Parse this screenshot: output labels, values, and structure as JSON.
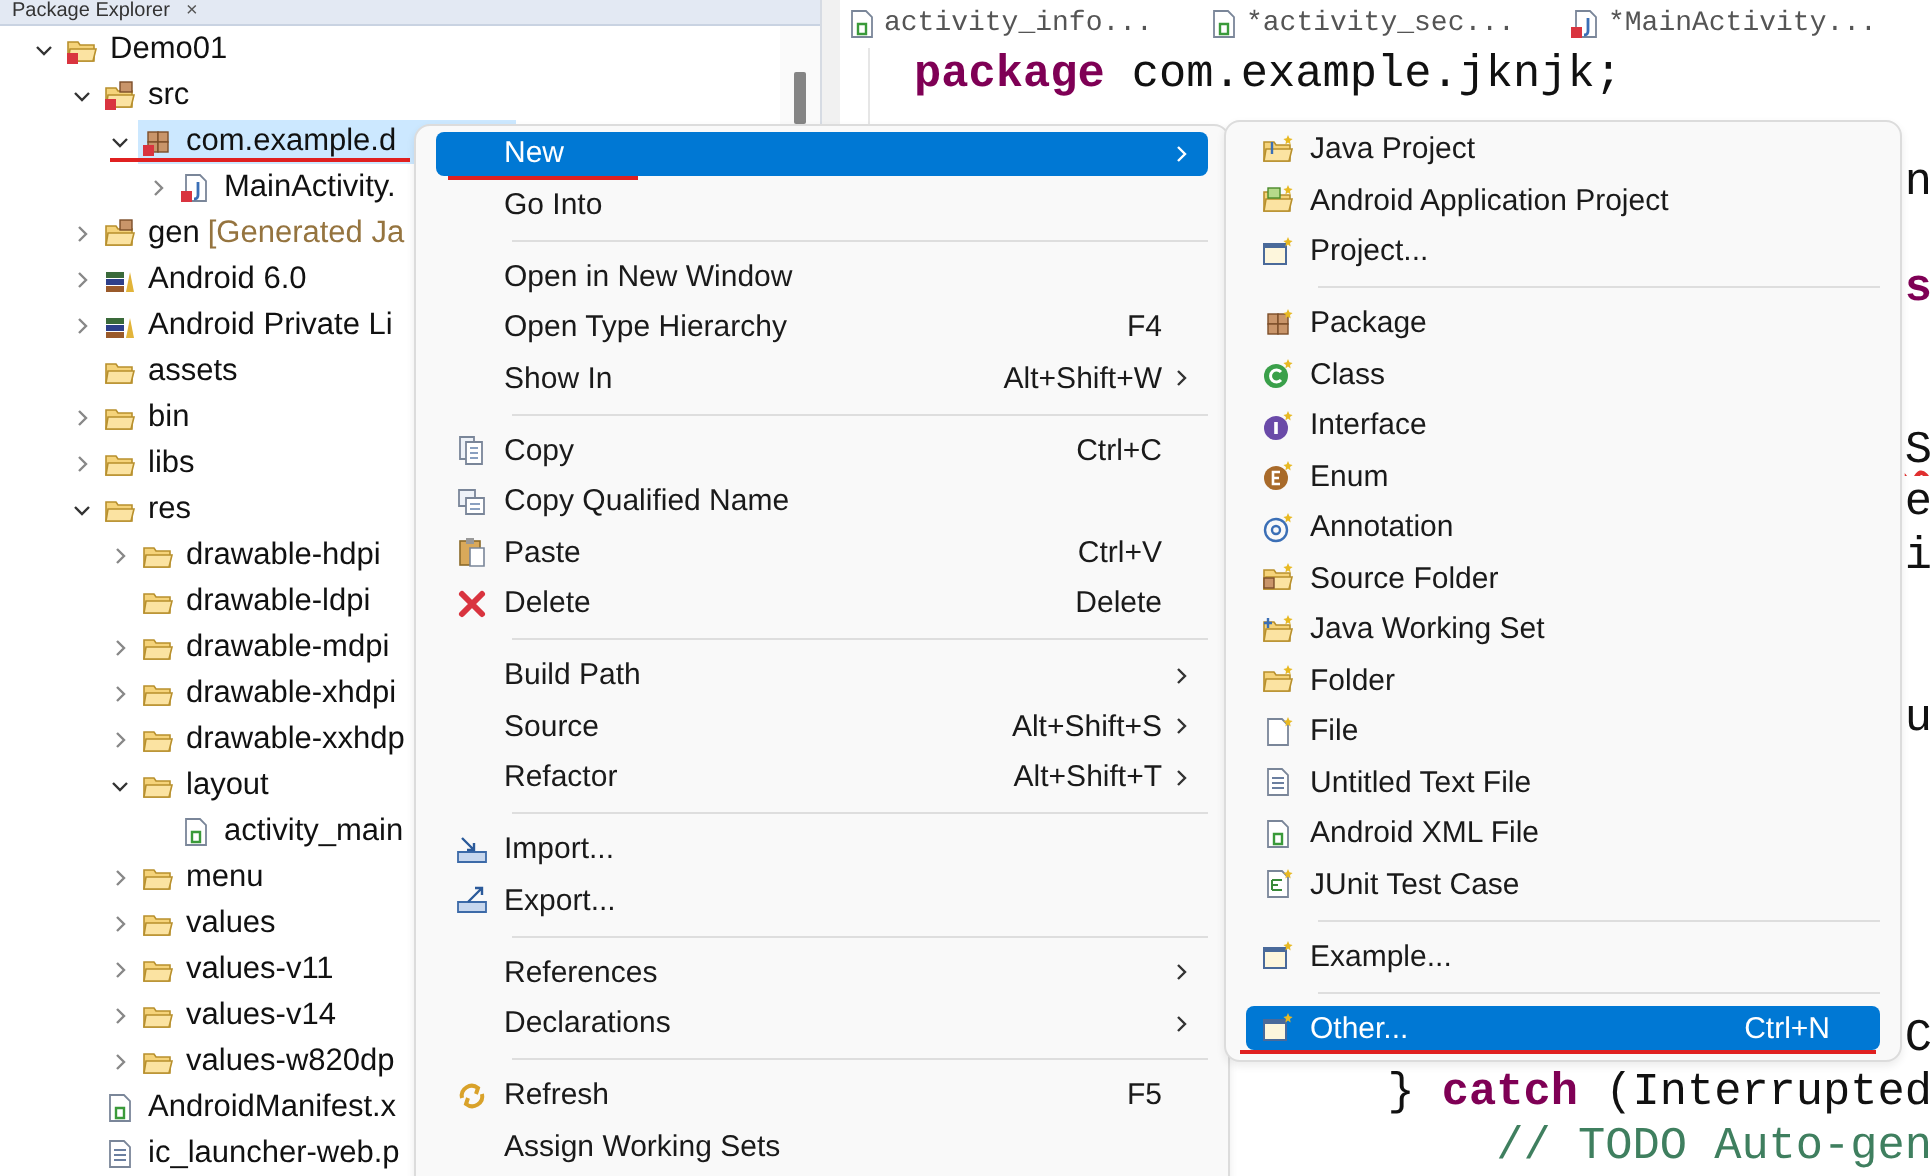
{
  "explorer": {
    "title": "Package Explorer",
    "close": "×",
    "tree": [
      {
        "label": "Demo01",
        "kind": "project",
        "expanded": true,
        "selected": false,
        "children": [
          {
            "label": "src",
            "kind": "source-folder",
            "expanded": true,
            "selected": false,
            "children": [
              {
                "label": "com.example.d",
                "kind": "package",
                "expanded": true,
                "selected": true,
                "children": [
                  {
                    "label": "MainActivity.",
                    "kind": "java-file",
                    "expanded": false,
                    "selected": false
                  }
                ]
              }
            ]
          },
          {
            "label": "gen",
            "decoration": "[Generated Ja",
            "kind": "gen-folder",
            "expanded": false,
            "selected": false
          },
          {
            "label": "Android 6.0",
            "kind": "library",
            "expanded": false,
            "selected": false
          },
          {
            "label": "Android Private Li",
            "kind": "library",
            "expanded": false,
            "selected": false
          },
          {
            "label": "assets",
            "kind": "folder",
            "selected": false
          },
          {
            "label": "bin",
            "kind": "folder",
            "expanded": false,
            "selected": false
          },
          {
            "label": "libs",
            "kind": "folder",
            "expanded": false,
            "selected": false
          },
          {
            "label": "res",
            "kind": "folder",
            "expanded": true,
            "selected": false,
            "children": [
              {
                "label": "drawable-hdpi",
                "kind": "folder",
                "expanded": false,
                "selected": false
              },
              {
                "label": "drawable-ldpi",
                "kind": "folder",
                "selected": false
              },
              {
                "label": "drawable-mdpi",
                "kind": "folder",
                "expanded": false,
                "selected": false
              },
              {
                "label": "drawable-xhdpi",
                "kind": "folder",
                "expanded": false,
                "selected": false
              },
              {
                "label": "drawable-xxhdp",
                "kind": "folder",
                "expanded": false,
                "selected": false
              },
              {
                "label": "layout",
                "kind": "folder",
                "expanded": true,
                "selected": false,
                "children": [
                  {
                    "label": "activity_main",
                    "kind": "xml-file",
                    "selected": false
                  }
                ]
              },
              {
                "label": "menu",
                "kind": "folder",
                "expanded": false,
                "selected": false
              },
              {
                "label": "values",
                "kind": "folder",
                "expanded": false,
                "selected": false
              },
              {
                "label": "values-v11",
                "kind": "folder",
                "expanded": false,
                "selected": false
              },
              {
                "label": "values-v14",
                "kind": "folder",
                "expanded": false,
                "selected": false
              },
              {
                "label": "values-w820dp",
                "kind": "folder",
                "expanded": false,
                "selected": false
              }
            ]
          },
          {
            "label": "AndroidManifest.x",
            "kind": "xml-file",
            "selected": false
          },
          {
            "label": "ic_launcher-web.p",
            "kind": "text-file",
            "selected": false
          }
        ]
      }
    ]
  },
  "editor": {
    "tabs": [
      {
        "label": "activity_info...",
        "kind": "xml-file"
      },
      {
        "label": "*activity_sec...",
        "kind": "xml-file"
      },
      {
        "label": "*MainActivity...",
        "kind": "java-file"
      }
    ],
    "code_lines": [
      {
        "kind": "head",
        "error": false,
        "segments": [
          {
            "text": "package",
            "kind": "keyword"
          },
          {
            "text": " com.example.jknjk;",
            "kind": "plain"
          }
        ]
      },
      {
        "kind": "tail",
        "error": false,
        "segments": [
          {
            "text": "n",
            "kind": "plain"
          }
        ]
      },
      {
        "kind": "tail",
        "error": false,
        "segments": [
          {
            "text": "s",
            "kind": "keyword"
          }
        ]
      },
      {
        "kind": "tail",
        "error": true,
        "segments": [
          {
            "text": "S",
            "kind": "plain"
          }
        ]
      },
      {
        "kind": "tail",
        "error": false,
        "segments": [
          {
            "text": "e",
            "kind": "plain"
          }
        ]
      },
      {
        "kind": "tail",
        "error": false,
        "segments": [
          {
            "text": "i",
            "kind": "plain"
          }
        ]
      },
      {
        "kind": "tail",
        "error": false,
        "segments": [
          {
            "text": "u",
            "kind": "plain"
          }
        ]
      },
      {
        "kind": "tail",
        "error": false,
        "segments": [
          {
            "text": "C",
            "kind": "plain"
          }
        ]
      },
      {
        "kind": "tail",
        "error": false,
        "segments": [
          {
            "text": "} ",
            "kind": "plain"
          },
          {
            "text": "catch",
            "kind": "keyword"
          },
          {
            "text": " (Interrupted",
            "kind": "plain"
          }
        ]
      },
      {
        "kind": "tail",
        "error": false,
        "segments": [
          {
            "text": "// TODO Auto-gen",
            "kind": "comment"
          }
        ]
      }
    ]
  },
  "context_menu": [
    {
      "kind": "plain",
      "label": "New",
      "submenu": true,
      "selected": true
    },
    {
      "kind": "plain",
      "label": "Go Into",
      "submenu": false,
      "selected": false
    },
    {
      "kind": "separator"
    },
    {
      "kind": "plain",
      "label": "Open in New Window",
      "submenu": false,
      "selected": false
    },
    {
      "kind": "plain",
      "label": "Open Type Hierarchy",
      "shortcut": "F4",
      "submenu": false,
      "selected": false
    },
    {
      "kind": "plain",
      "label": "Show In",
      "shortcut": "Alt+Shift+W",
      "submenu": true,
      "selected": false
    },
    {
      "kind": "separator"
    },
    {
      "kind": "copy",
      "label": "Copy",
      "shortcut": "Ctrl+C",
      "submenu": false,
      "selected": false
    },
    {
      "kind": "copy-name",
      "label": "Copy Qualified Name",
      "submenu": false,
      "selected": false
    },
    {
      "kind": "paste",
      "label": "Paste",
      "shortcut": "Ctrl+V",
      "submenu": false,
      "selected": false
    },
    {
      "kind": "delete",
      "label": "Delete",
      "shortcut": "Delete",
      "submenu": false,
      "selected": false
    },
    {
      "kind": "separator"
    },
    {
      "kind": "plain",
      "label": "Build Path",
      "submenu": true,
      "selected": false
    },
    {
      "kind": "plain",
      "label": "Source",
      "shortcut": "Alt+Shift+S",
      "submenu": true,
      "selected": false
    },
    {
      "kind": "plain",
      "label": "Refactor",
      "shortcut": "Alt+Shift+T",
      "submenu": true,
      "selected": false
    },
    {
      "kind": "separator"
    },
    {
      "kind": "import",
      "label": "Import...",
      "submenu": false,
      "selected": false
    },
    {
      "kind": "export",
      "label": "Export...",
      "submenu": false,
      "selected": false
    },
    {
      "kind": "separator"
    },
    {
      "kind": "plain",
      "label": "References",
      "submenu": true,
      "selected": false
    },
    {
      "kind": "plain",
      "label": "Declarations",
      "submenu": true,
      "selected": false
    },
    {
      "kind": "separator"
    },
    {
      "kind": "refresh",
      "label": "Refresh",
      "shortcut": "F5",
      "submenu": false,
      "selected": false
    },
    {
      "kind": "plain",
      "label": "Assign Working Sets",
      "submenu": false,
      "selected": false
    }
  ],
  "new_submenu": [
    {
      "kind": "new-project",
      "label": "Java Project",
      "selected": false
    },
    {
      "kind": "new-android-project",
      "label": "Android Application Project",
      "selected": false
    },
    {
      "kind": "new-wizard",
      "label": "Project...",
      "selected": false
    },
    {
      "kind": "separator"
    },
    {
      "kind": "new-package",
      "label": "Package",
      "selected": false
    },
    {
      "kind": "class",
      "label": "Class",
      "selected": false
    },
    {
      "kind": "interface",
      "label": "Interface",
      "selected": false
    },
    {
      "kind": "enum",
      "label": "Enum",
      "selected": false
    },
    {
      "kind": "annotation",
      "label": "Annotation",
      "selected": false
    },
    {
      "kind": "new-source-folder",
      "label": "Source Folder",
      "selected": false
    },
    {
      "kind": "working-set",
      "label": "Java Working Set",
      "selected": false
    },
    {
      "kind": "new-folder",
      "label": "Folder",
      "selected": false
    },
    {
      "kind": "new-file",
      "label": "File",
      "selected": false
    },
    {
      "kind": "text-file",
      "label": "Untitled Text File",
      "selected": false
    },
    {
      "kind": "xml-file",
      "label": "Android XML File",
      "selected": false
    },
    {
      "kind": "junit",
      "label": "JUnit Test Case",
      "selected": false
    },
    {
      "kind": "separator"
    },
    {
      "kind": "new-wizard",
      "label": "Example...",
      "selected": false
    },
    {
      "kind": "separator"
    },
    {
      "kind": "new-wizard",
      "label": "Other...",
      "shortcut": "Ctrl+N",
      "selected": true
    }
  ]
}
